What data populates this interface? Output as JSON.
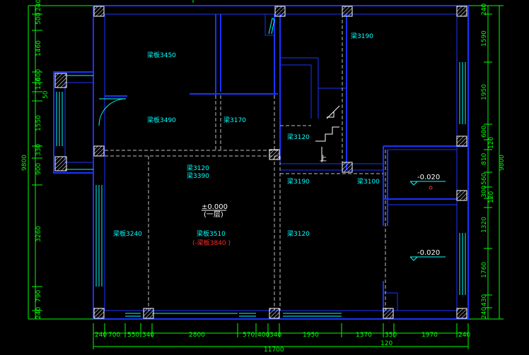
{
  "top_dims": [
    "240",
    "700",
    "550",
    "340",
    "2800",
    "570",
    "400",
    "340",
    "1950",
    "1370",
    "350",
    "1970",
    "240"
  ],
  "overall_bottom": "11700",
  "bottom_small": "120",
  "left_dims": [
    "240",
    "500",
    "1460",
    "600",
    "120",
    "50",
    "1550",
    "330",
    "900",
    "3260",
    "790",
    "240"
  ],
  "left_total": "9800",
  "right_dims": [
    "240",
    "1590",
    "1950",
    "600",
    "120",
    "810",
    "560",
    "300",
    "120",
    "1320",
    "1760",
    "430",
    "240"
  ],
  "right_total": "9800",
  "room_labels": {
    "r1": "梁板3450",
    "r2": "梁板3490",
    "r3": "梁3190",
    "r4": "梁3170",
    "r5": "梁3120",
    "r6": "梁3120",
    "r7": "梁3390",
    "r8": "梁3190",
    "r9": "梁3100",
    "r10": "梁板3240",
    "r11": "梁板3510",
    "r12": "梁3120"
  },
  "elev_main": "±0.000",
  "elev_main_sub": "(一层)",
  "elev_red": "(-梁板3840 )",
  "elev_r1": "-0.020",
  "elev_r2": "-0.020",
  "stair_mark": "上"
}
